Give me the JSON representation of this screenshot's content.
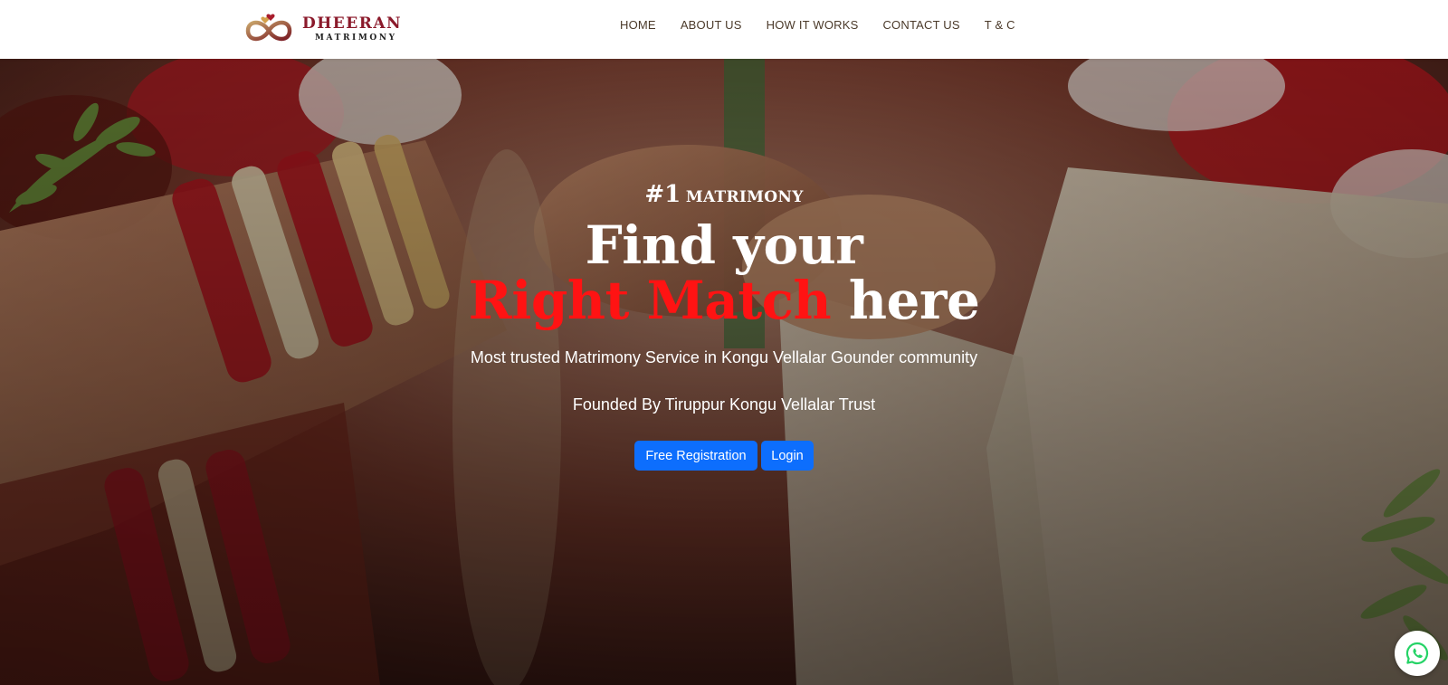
{
  "header": {
    "logo": {
      "name": "DHEERAN",
      "sub": "MATRIMONY"
    },
    "nav": [
      {
        "label": "HOME"
      },
      {
        "label": "ABOUT US"
      },
      {
        "label": "HOW IT WORKS"
      },
      {
        "label": "CONTACT US"
      },
      {
        "label": "T & C"
      }
    ]
  },
  "hero": {
    "tag_number": "#1",
    "tag_word": "MATRIMONY",
    "headline_line1": "Find your",
    "headline_highlight": "Right Match",
    "headline_rest": "here",
    "subtitle": "Most trusted Matrimony Service in Kongu Vellalar Gounder community",
    "founded": "Founded By Tiruppur Kongu Vellalar Trust",
    "buttons": {
      "register": "Free Registration",
      "login": "Login"
    }
  },
  "floating": {
    "icon": "whatsapp-icon"
  },
  "colors": {
    "brand": "#8b1a2b",
    "highlight": "#ff1313",
    "button": "#0d6efd",
    "whatsapp": "#25d366"
  }
}
